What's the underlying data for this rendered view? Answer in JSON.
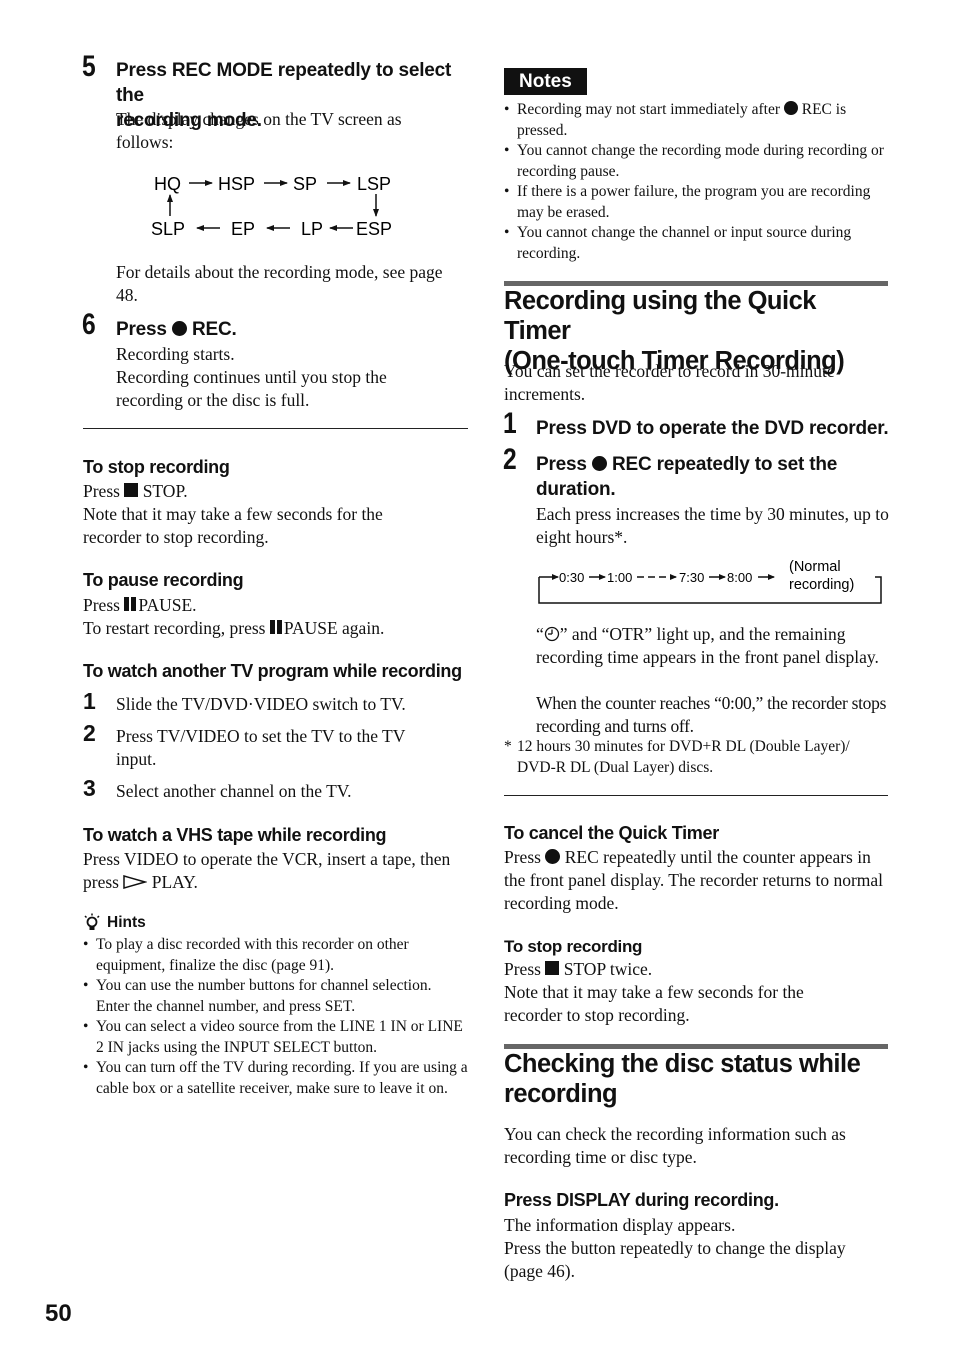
{
  "page_number": "50",
  "left": {
    "step5": {
      "number": "5",
      "title_line1": "Press REC MODE repeatedly to select the",
      "title_line2": "recording mode.",
      "body": "The display changes on the TV screen as follows:",
      "mode_diagram": {
        "top_row": [
          "HQ",
          "HSP",
          "SP",
          "LSP"
        ],
        "bottom_row": [
          "SLP",
          "EP",
          "LP",
          "ESP"
        ]
      },
      "details": "For details about the recording mode, see page 48."
    },
    "step6": {
      "number": "6",
      "title_pre": "Press",
      "title_post": "REC.",
      "body_line1": "Recording starts.",
      "body_line2": "Recording continues until you stop the recording or the disc is full."
    },
    "stop": {
      "heading": "To stop recording",
      "press_pre": "Press",
      "press_post": "STOP.",
      "note": "Note that it may take a few seconds for the recorder to stop recording."
    },
    "pause": {
      "heading": "To pause recording",
      "press_pre": "Press",
      "press_post": "PAUSE.",
      "restart_pre": "To restart recording, press",
      "restart_post": "PAUSE again."
    },
    "watch_tv": {
      "heading": "To watch another TV program while recording",
      "steps": [
        {
          "num": "1",
          "text": "Slide the TV/DVD·VIDEO switch to TV."
        },
        {
          "num": "2",
          "text": "Press TV/VIDEO to set the TV to the TV input."
        },
        {
          "num": "3",
          "text": "Select another channel on the TV."
        }
      ]
    },
    "watch_vhs": {
      "heading": "To watch a VHS tape while recording",
      "body_pre": "Press VIDEO to operate the VCR, insert a tape, then press",
      "body_post": "PLAY."
    },
    "hints": {
      "label": "Hints",
      "items": [
        "To play a disc recorded with this recorder on other equipment, finalize the disc (page 91).",
        "You can use the number buttons for channel selection. Enter the channel number, and press SET.",
        "You can select a video source from the LINE 1 IN or LINE 2 IN jacks using the INPUT SELECT button.",
        "You can turn off the TV during recording. If you are using a cable box or a satellite receiver, make sure to leave it on."
      ]
    }
  },
  "right": {
    "notes": {
      "label": "Notes",
      "item1_pre": "Recording may not start immediately after",
      "item1_post": "REC is pressed.",
      "items": [
        "You cannot change the recording mode during recording or recording pause.",
        "If there is a power failure, the program you are recording may be erased.",
        "You cannot change the channel or input source during recording."
      ]
    },
    "quick_timer": {
      "heading_line1": "Recording using the Quick Timer",
      "heading_line2": "(One-touch Timer Recording)",
      "intro": "You can set the recorder to record in 30-minute increments.",
      "step1": {
        "num": "1",
        "title": "Press DVD to operate the DVD recorder."
      },
      "step2": {
        "num": "2",
        "title_pre": "Press",
        "title_post_line1": "REC repeatedly to set the",
        "title_line2": "duration.",
        "body": "Each press increases the time by 30 minutes, up to eight hours*."
      },
      "timer_diagram": {
        "times": [
          "0:30",
          "1:00",
          "7:30",
          "8:00"
        ],
        "end_label_line1": "(Normal",
        "end_label_line2": "recording)"
      },
      "otr_pre": "“",
      "otr_post": "” and “OTR” light up, and the remaining recording time appears in the front panel display.",
      "counter": "When the counter reaches “0:00,” the recorder stops recording and turns off.",
      "footnote_mark": "*",
      "footnote": "12 hours 30 minutes for DVD+R DL (Double Layer)/ DVD-R DL (Dual Layer) discs."
    },
    "cancel": {
      "heading": "To cancel the Quick Timer",
      "body_pre": "Press",
      "body_post": "REC repeatedly until the counter appears in the front panel display. The recorder returns to normal recording mode."
    },
    "stop": {
      "heading": "To stop recording",
      "press_pre": "Press",
      "press_post": "STOP twice.",
      "note": "Note that it may take a few seconds for the recorder to stop recording."
    },
    "disc_status": {
      "heading_line1": "Checking the disc status while",
      "heading_line2": "recording",
      "intro": "You can check the recording information such as recording time or disc type.",
      "step_title": "Press DISPLAY during recording.",
      "body_line1": "The information display appears.",
      "body_line2": "Press the button repeatedly to change the display (page 46)."
    }
  }
}
